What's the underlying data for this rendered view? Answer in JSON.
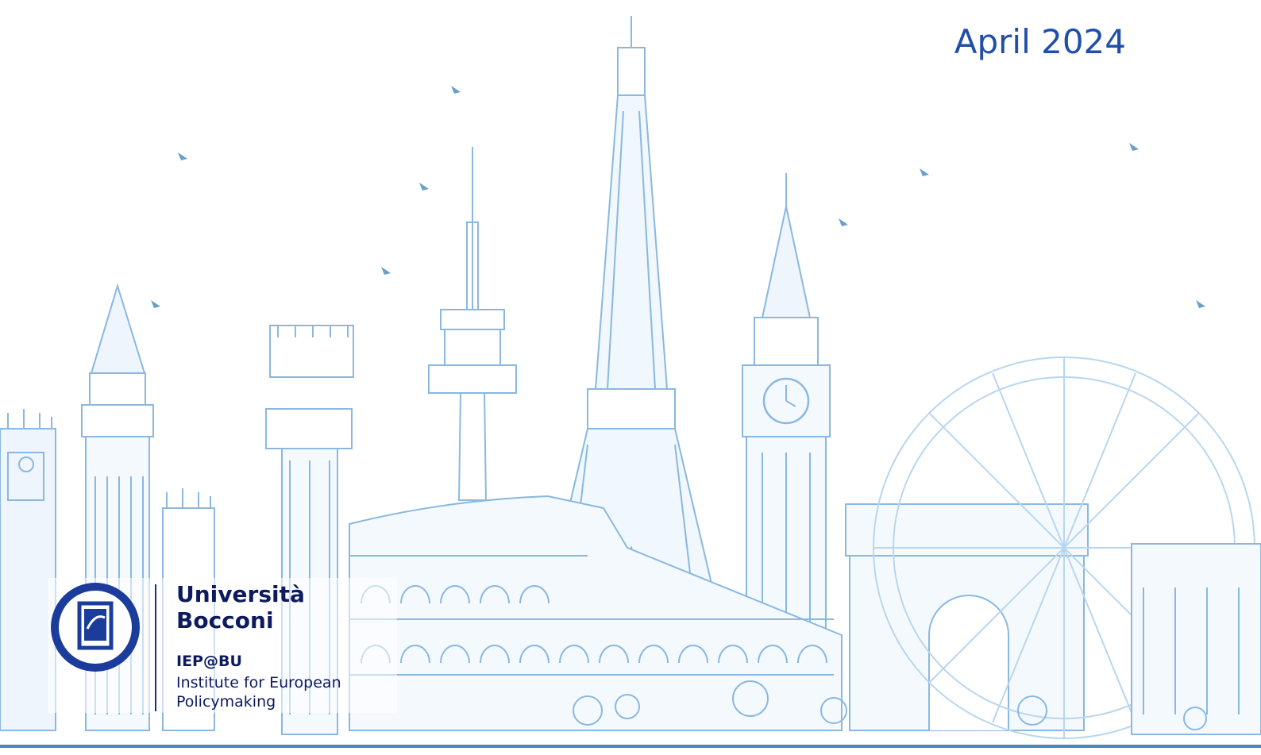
{
  "header": {
    "date": "April 2024"
  },
  "logo": {
    "university_line1": "Università",
    "university_line2": "Bocconi",
    "institute_acronym": "IEP@BU",
    "institute_line1": "Institute for European",
    "institute_line2": "Policymaking"
  },
  "colors": {
    "date_text": "#1f4fa8",
    "logo_navy": "#0d1a5e",
    "skyline_line": "#8ab8e0",
    "skyline_fill": "#e8f2fb"
  },
  "icons": [
    "university-seal-icon",
    "bird-icon"
  ]
}
